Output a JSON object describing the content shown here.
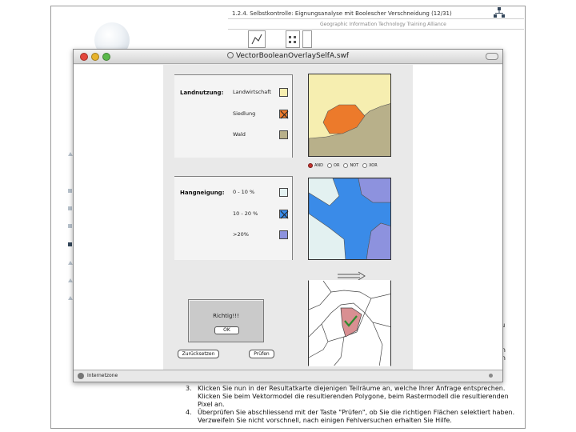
{
  "background_page": {
    "title": "1.2.4. Selbstkontrolle: Eignungsanalyse mit Boolescher Verschneidung (12/31)",
    "subtitle": "Geographic Information Technology Training Alliance",
    "right_fragments": [
      "zu",
      "en",
      "en"
    ]
  },
  "window": {
    "title": "VectorBooleanOverlaySelfA.swf",
    "status_text": "Internetzone"
  },
  "landnutzung": {
    "heading": "Landnutzung:",
    "rows": [
      {
        "label": "Landwirtschaft",
        "color": "#f6eeb0",
        "checked": false
      },
      {
        "label": "Siedlung",
        "color": "#ec7a2b",
        "checked": true
      },
      {
        "label": "Wald",
        "color": "#b8b08a",
        "checked": false
      }
    ]
  },
  "hangneigung": {
    "heading": "Hangneigung:",
    "rows": [
      {
        "label": "0 - 10 %",
        "color": "#e3f1f1",
        "checked": false
      },
      {
        "label": "10 - 20 %",
        "color": "#3a8be8",
        "checked": true
      },
      {
        "label": ">20%",
        "color": "#8d92de",
        "checked": false
      }
    ]
  },
  "operators": [
    {
      "label": "AND",
      "selected": true
    },
    {
      "label": "OR",
      "selected": false
    },
    {
      "label": "NOT",
      "selected": false
    },
    {
      "label": "XOR",
      "selected": false
    }
  ],
  "result": {
    "dialog_text": "Richtig!!!",
    "ok_label": "OK",
    "reset_label": "Zurücksetzen",
    "check_label": "Prüfen",
    "check_mark_color": "#2e8b2e",
    "selected_color": "#d98f92"
  },
  "instructions": [
    {
      "num": "3.",
      "text": "Klicken Sie nun in der Resultatkarte diejenigen Teilräume an, welche Ihrer Anfrage entsprechen. Klicken Sie beim Vektormodel die resultierenden Polygone, beim Rastermodell die resultierenden Pixel an."
    },
    {
      "num": "4.",
      "text": "Überprüfen Sie abschliessend mit der Taste \"Prüfen\", ob Sie die richtigen Flächen selektiert haben. Verzweifeln Sie nicht vorschnell, nach einigen Fehlversuchen erhalten Sie Hilfe."
    }
  ]
}
